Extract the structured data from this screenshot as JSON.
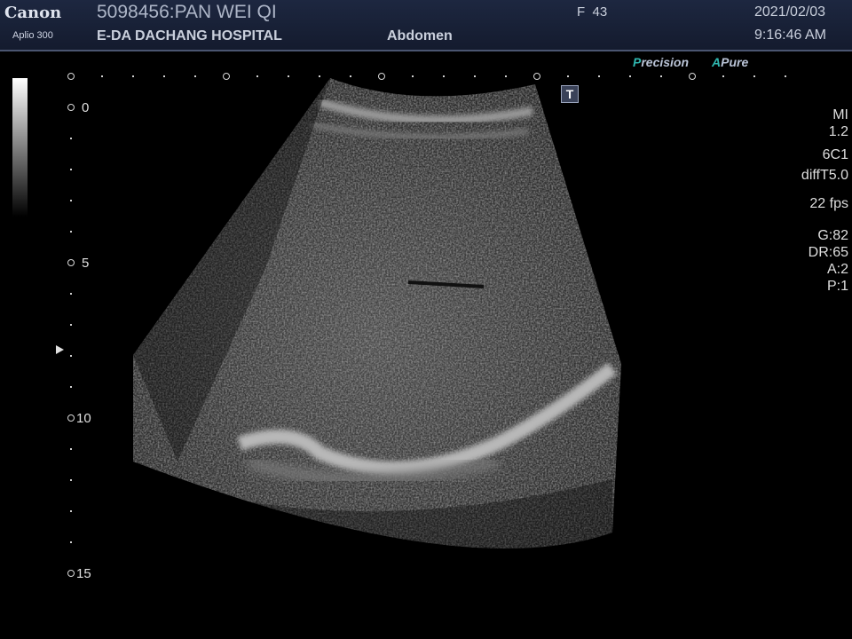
{
  "header": {
    "brand": "Canon",
    "model": "Aplio 300",
    "patient": "5098456:PAN WEI QI",
    "hospital": "E-DA DACHANG HOSPITAL",
    "exam": "Abdomen",
    "sex_age": "F  43",
    "date": "2021/02/03",
    "time": "9:16:46 AM"
  },
  "modes": {
    "precision_accent": "P",
    "precision_rest": "recision",
    "apure_accent": "A",
    "apure_rest": "Pure"
  },
  "depth_labels": [
    "0",
    "5",
    "10",
    "15"
  ],
  "t_marker": "T",
  "params": {
    "mi_label": "MI",
    "mi_value": "1.2",
    "probe": "6C1",
    "harmonic": "diffT5.0",
    "fps": "22 fps",
    "gain": "G:82",
    "dynamic_range": "DR:65",
    "a": "A:2",
    "p": "P:1"
  },
  "colors": {
    "header_bg": "#1a2238",
    "accent": "#2fb7b0",
    "text": "#e8e8e8"
  }
}
